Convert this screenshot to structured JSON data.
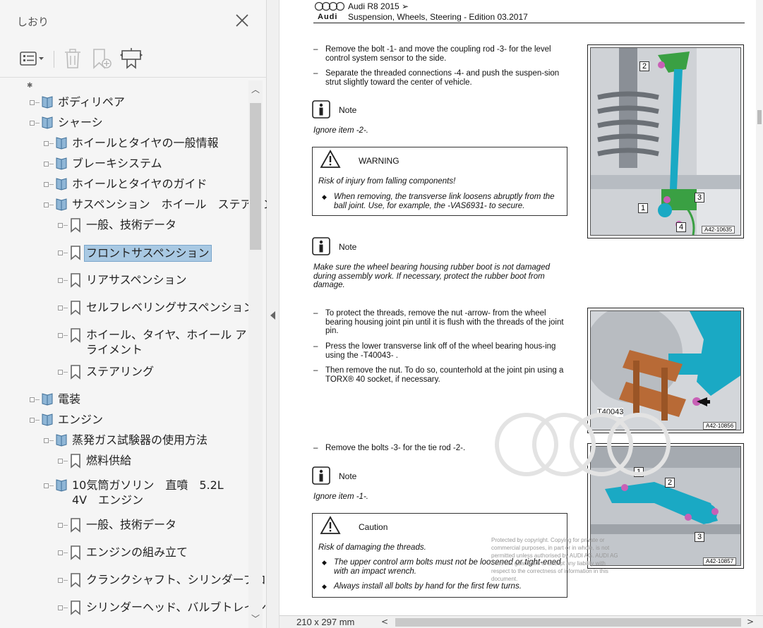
{
  "panel": {
    "title": "しおり",
    "close_label": "×"
  },
  "toolbar": {
    "options_icon": "list-options-icon",
    "delete_icon": "trash-icon",
    "new_bookmark_icon": "add-bookmark-icon",
    "expand_icon": "bookmark-expand-icon"
  },
  "tree": {
    "items": [
      {
        "label": "ボディリペア",
        "level": 0,
        "icon": "book"
      },
      {
        "label": "シャーシ",
        "level": 0,
        "icon": "book"
      },
      {
        "label": "ホイールとタイヤの一般情報",
        "level": 1,
        "icon": "book"
      },
      {
        "label": "ブレーキシステム",
        "level": 1,
        "icon": "book"
      },
      {
        "label": "ホイールとタイヤのガイド",
        "level": 1,
        "icon": "book"
      },
      {
        "label": "サスペンション　ホイール　ステアリング",
        "level": 1,
        "icon": "book"
      },
      {
        "label": "一般、技術データ",
        "level": 2,
        "icon": "bookmark"
      },
      {
        "label": "フロントサスペンション",
        "level": 2,
        "icon": "bookmark",
        "selected": true
      },
      {
        "label": "リアサスペンション",
        "level": 2,
        "icon": "bookmark"
      },
      {
        "label": "セルフレベリングサスペンション",
        "level": 2,
        "icon": "bookmark"
      },
      {
        "label": "ホイール、タイヤ、ホイール アライメント",
        "level": 2,
        "icon": "bookmark"
      },
      {
        "label": "ステアリング",
        "level": 2,
        "icon": "bookmark"
      },
      {
        "label": "電装",
        "level": 0,
        "icon": "book"
      },
      {
        "label": "エンジン",
        "level": 0,
        "icon": "book"
      },
      {
        "label": "蒸発ガス試験器の使用方法",
        "level": 1,
        "icon": "book"
      },
      {
        "label": "燃料供給",
        "level": 2,
        "icon": "bookmark"
      },
      {
        "label": "10気筒ガソリン　直噴　5.2L　4V　エンジン",
        "level": 1,
        "icon": "book"
      },
      {
        "label": "一般、技術データ",
        "level": 2,
        "icon": "bookmark"
      },
      {
        "label": "エンジンの組み立て",
        "level": 2,
        "icon": "bookmark"
      },
      {
        "label": "クランクシャフト、シリンダーブロック",
        "level": 2,
        "icon": "bookmark"
      },
      {
        "label": "シリンダーヘッド、バルブトレイン",
        "level": 2,
        "icon": "bookmark"
      }
    ]
  },
  "doc": {
    "header_title": "Audi R8 2015 ➢",
    "header_subtitle": "Suspension, Wheels, Steering - Edition 03.2017",
    "logo_text": "Audi",
    "step1a": "Remove the bolt -1- and move the coupling rod -3- for the level control system sensor to the side.",
    "step1b": "Separate the threaded connections -4- and push the suspen-sion strut slightly toward the center of vehicle.",
    "note1_label": "Note",
    "note1_text": "Ignore item -2-.",
    "warning_label": "WARNING",
    "warning_head": "Risk of injury from falling components!",
    "warning_item": "When removing, the transverse link loosens abruptly from the ball joint. Use, for example, the -VAS6931- to secure.",
    "note2_label": "Note",
    "note2_text": "Make sure the wheel bearing housing rubber boot is not damaged during assembly work. If necessary, protect the rubber boot from damage.",
    "step2a": "To protect the threads, remove the nut -arrow- from the wheel bearing housing joint pin until it is flush with the threads of the joint pin.",
    "step2b": "Press the lower transverse link off of the wheel bearing hous-ing using the -T40043- .",
    "step2c": "Then remove the nut. To do so, counterhold at the joint pin using a TORX® 40 socket, if necessary.",
    "step3": "Remove the bolts -3- for the tie rod -2-.",
    "note3_label": "Note",
    "note3_text": "Ignore item -1-.",
    "caution_label": "Caution",
    "caution_head": "Risk of damaging the threads.",
    "caution_item1": "The upper control arm bolts must not be loosened or tight-ened with an impact wrench.",
    "caution_item2": "Always install all bolts by hand for the first few turns.",
    "fig1_id": "A42-10635",
    "fig2_id": "A42-10856",
    "fig3_id": "A42-10857",
    "fig2_tool": "T40043",
    "fig1_callouts": [
      "2",
      "1",
      "3",
      "4"
    ],
    "fig3_callouts": [
      "1",
      "2",
      "3"
    ],
    "watermark": "Protected by copyright. Copying for private or commercial purposes, in part or in whole, is not permitted unless authorised by AUDI AG. AUDI AG does not guarantee or accept any liability with respect to the correctness of information in this document."
  },
  "status": {
    "page_size": "210 x 297 mm"
  },
  "colors": {
    "selection": "#a9c9e3",
    "panel_bg": "#f5f5f5",
    "part_teal": "#1aa9c4",
    "part_copper": "#b86a36",
    "part_green": "#3aa043"
  }
}
